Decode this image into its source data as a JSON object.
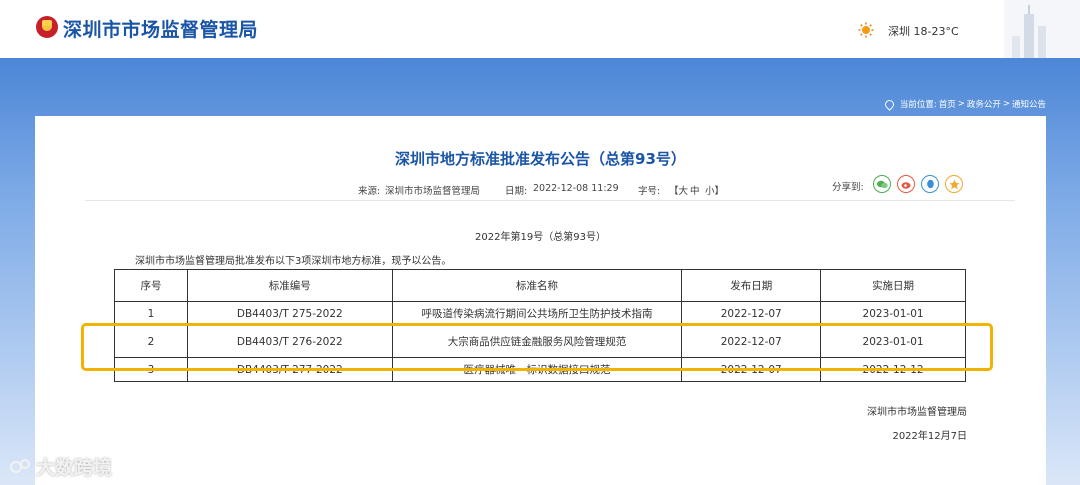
{
  "header": {
    "site_title": "深圳市市场监督管理局",
    "weather": "深圳 18-23°C"
  },
  "breadcrumb": {
    "prefix": "当前位置:",
    "items": [
      "首页",
      "政务公开",
      "通知公告"
    ],
    "separator": ">"
  },
  "article": {
    "title": "深圳市地方标准批准发布公告（总第93号）",
    "source_label": "来源:",
    "source": "深圳市市场监督管理局",
    "date_label": "日期:",
    "date": "2022-12-08 11:29",
    "font_size_label": "字号:",
    "font_size_options": [
      "【大",
      "中",
      "小】"
    ],
    "share_label": "分享到:",
    "share_icons": [
      "wechat-icon",
      "weibo-icon",
      "qq-icon",
      "qzone-icon"
    ],
    "subtitle": "2022年第19号（总第93号）",
    "intro": "深圳市市场监督管理局批准发布以下3项深圳市地方标准，现予以公告。",
    "signature_org": "深圳市市场监督管理局",
    "signature_date": "2022年12月7日"
  },
  "table": {
    "headers": [
      "序号",
      "标准编号",
      "标准名称",
      "发布日期",
      "实施日期"
    ],
    "rows": [
      [
        "1",
        "DB4403/T 275-2022",
        "呼吸道传染病流行期间公共场所卫生防护技术指南",
        "2022-12-07",
        "2023-01-01"
      ],
      [
        "2",
        "DB4403/T 276-2022",
        "大宗商品供应链金融服务风险管理规范",
        "2022-12-07",
        "2023-01-01"
      ],
      [
        "3",
        "DB4403/T 277-2022",
        "医疗器械唯一标识数据接口规范",
        "2022-12-07",
        "2022-12-12"
      ]
    ]
  },
  "watermark": "大数跨境",
  "colors": {
    "brand_blue": "#1a55a6",
    "highlight": "#f1b300"
  }
}
